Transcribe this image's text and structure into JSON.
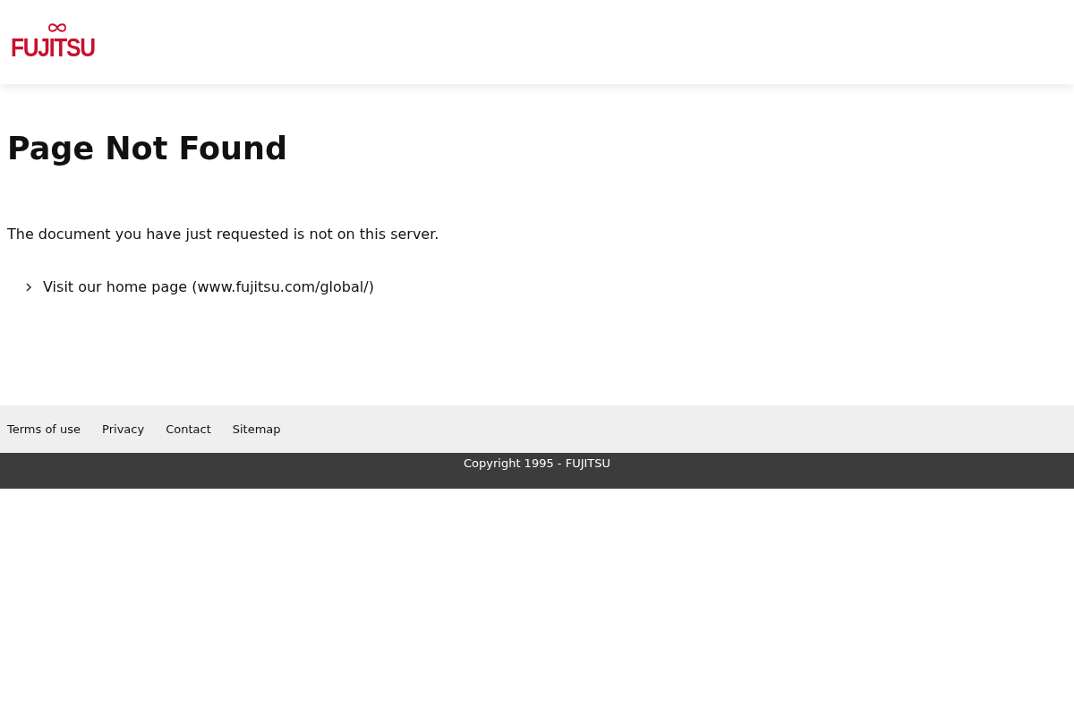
{
  "header": {
    "logo": "FUJITSU"
  },
  "title": "Page Not Found",
  "message": "The document you have just requested is not on this server.",
  "links": [
    "Visit our home page (www.fujitsu.com/global/)"
  ],
  "footer": {
    "links": [
      "Terms of use",
      "Privacy",
      "Contact",
      "Sitemap"
    ],
    "copyright": "Copyright 1995 - FUJITSU"
  }
}
